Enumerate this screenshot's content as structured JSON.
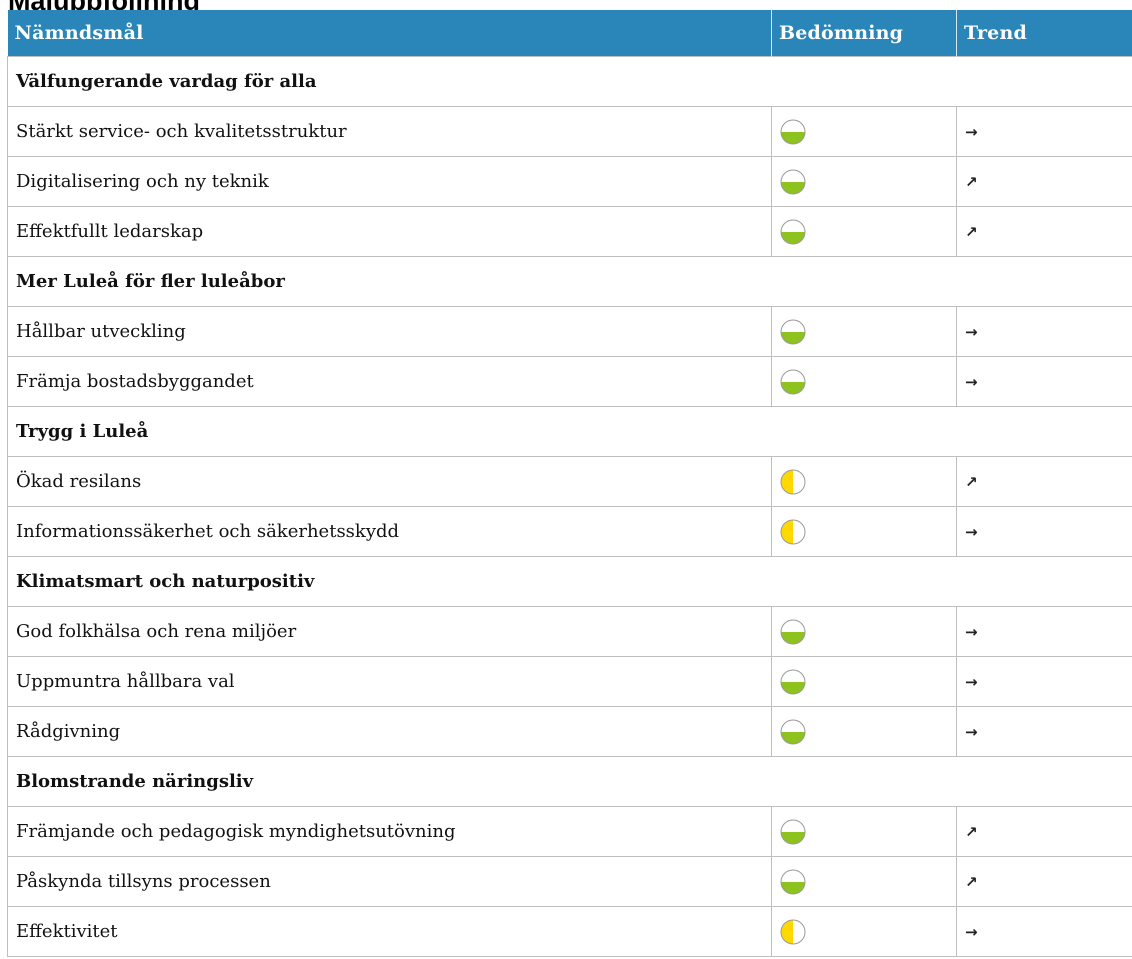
{
  "page": {
    "title": "Måluppföljning"
  },
  "columns": {
    "goal": "Nämndsmål",
    "assessment": "Bedömning",
    "trend": "Trend"
  },
  "colors": {
    "header_bg": "#2a86b8",
    "header_text": "#ffffff",
    "rating_green": "#8dc21f",
    "rating_yellow": "#ffd800",
    "grid": "#bfbfbf"
  },
  "legend_icons": {
    "half-green-circle": "bottom half filled green",
    "half-yellow-circle": "left half filled yellow",
    "arrow-right": "trend unchanged",
    "arrow-up-right": "trend improving"
  },
  "rows": [
    {
      "type": "category",
      "label": "Välfungerande vardag för alla"
    },
    {
      "type": "goal",
      "label": "Stärkt service- och kvalitetsstruktur",
      "rating": "green",
      "trend": "right"
    },
    {
      "type": "goal",
      "label": "Digitalisering och ny teknik",
      "rating": "green",
      "trend": "up-right"
    },
    {
      "type": "goal",
      "label": "Effektfullt ledarskap",
      "rating": "green",
      "trend": "up-right"
    },
    {
      "type": "category",
      "label": "Mer Luleå för fler luleåbor"
    },
    {
      "type": "goal",
      "label": "Hållbar utveckling",
      "rating": "green",
      "trend": "right"
    },
    {
      "type": "goal",
      "label": "Främja bostadsbyggandet",
      "rating": "green",
      "trend": "right"
    },
    {
      "type": "category",
      "label": "Trygg i Luleå"
    },
    {
      "type": "goal",
      "label": "Ökad resilans",
      "rating": "yellow",
      "trend": "up-right"
    },
    {
      "type": "goal",
      "label": "Informationssäkerhet och säkerhetsskydd",
      "rating": "yellow",
      "trend": "right"
    },
    {
      "type": "category",
      "label": "Klimatsmart och naturpositiv"
    },
    {
      "type": "goal",
      "label": "God folkhälsa och rena miljöer",
      "rating": "green",
      "trend": "right"
    },
    {
      "type": "goal",
      "label": "Uppmuntra hållbara val",
      "rating": "green",
      "trend": "right"
    },
    {
      "type": "goal",
      "label": "Rådgivning",
      "rating": "green",
      "trend": "right"
    },
    {
      "type": "category",
      "label": "Blomstrande näringsliv"
    },
    {
      "type": "goal",
      "label": "Främjande och pedagogisk myndighetsutövning",
      "rating": "green",
      "trend": "up-right"
    },
    {
      "type": "goal",
      "label": "Påskynda tillsyns processen",
      "rating": "green",
      "trend": "up-right"
    },
    {
      "type": "goal",
      "label": "Effektivitet",
      "rating": "yellow",
      "trend": "right"
    }
  ]
}
